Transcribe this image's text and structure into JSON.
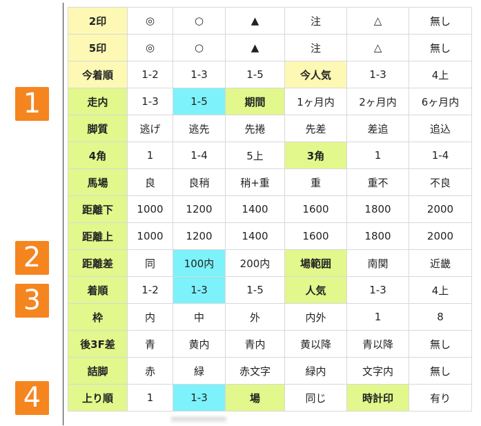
{
  "badges": [
    "1",
    "2",
    "3",
    "4"
  ],
  "colors": {
    "header_green": "#e2f78c",
    "header_yellow": "#fdf8b4",
    "highlight_cyan": "#7df2fb",
    "badge_orange": "#f5851f"
  },
  "rows": [
    {
      "cells": [
        {
          "text": "2印",
          "hdr": true,
          "color": "yellow"
        },
        {
          "text": "◎"
        },
        {
          "text": "○"
        },
        {
          "text": "▲"
        },
        {
          "text": "注"
        },
        {
          "text": "△"
        },
        {
          "text": "無し"
        }
      ]
    },
    {
      "cells": [
        {
          "text": "5印",
          "hdr": true,
          "color": "yellow"
        },
        {
          "text": "◎"
        },
        {
          "text": "○"
        },
        {
          "text": "▲"
        },
        {
          "text": "注"
        },
        {
          "text": "△"
        },
        {
          "text": "無し"
        }
      ]
    },
    {
      "cells": [
        {
          "text": "今着順",
          "hdr": true,
          "color": "yellow"
        },
        {
          "text": "1-2"
        },
        {
          "text": "1-3"
        },
        {
          "text": "1-5"
        },
        {
          "text": "今人気",
          "hdr": true,
          "color": "yellow"
        },
        {
          "text": "1-3"
        },
        {
          "text": "4上"
        }
      ]
    },
    {
      "cells": [
        {
          "text": "走内",
          "hdr": true,
          "color": "green"
        },
        {
          "text": "1-3"
        },
        {
          "text": "1-5",
          "color": "cyan"
        },
        {
          "text": "期間",
          "hdr": true,
          "color": "green"
        },
        {
          "text": "1ヶ月内"
        },
        {
          "text": "2ヶ月内"
        },
        {
          "text": "6ヶ月内"
        }
      ]
    },
    {
      "cells": [
        {
          "text": "脚質",
          "hdr": true,
          "color": "green"
        },
        {
          "text": "逃げ"
        },
        {
          "text": "逃先"
        },
        {
          "text": "先捲"
        },
        {
          "text": "先差"
        },
        {
          "text": "差追"
        },
        {
          "text": "追込"
        }
      ]
    },
    {
      "cells": [
        {
          "text": "4角",
          "hdr": true,
          "color": "green"
        },
        {
          "text": "1"
        },
        {
          "text": "1-4"
        },
        {
          "text": "5上"
        },
        {
          "text": "3角",
          "hdr": true,
          "color": "green"
        },
        {
          "text": "1"
        },
        {
          "text": "1-4"
        }
      ]
    },
    {
      "cells": [
        {
          "text": "馬場",
          "hdr": true,
          "color": "green"
        },
        {
          "text": "良"
        },
        {
          "text": "良稍"
        },
        {
          "text": "稍+重"
        },
        {
          "text": "重"
        },
        {
          "text": "重不"
        },
        {
          "text": "不良"
        }
      ]
    },
    {
      "cells": [
        {
          "text": "距離下",
          "hdr": true,
          "color": "green"
        },
        {
          "text": "1000"
        },
        {
          "text": "1200"
        },
        {
          "text": "1400"
        },
        {
          "text": "1600"
        },
        {
          "text": "1800"
        },
        {
          "text": "2000"
        }
      ]
    },
    {
      "cells": [
        {
          "text": "距離上",
          "hdr": true,
          "color": "green"
        },
        {
          "text": "1000"
        },
        {
          "text": "1200"
        },
        {
          "text": "1400"
        },
        {
          "text": "1600"
        },
        {
          "text": "1800"
        },
        {
          "text": "2000"
        }
      ]
    },
    {
      "cells": [
        {
          "text": "距離差",
          "hdr": true,
          "color": "green"
        },
        {
          "text": "同"
        },
        {
          "text": "100内",
          "color": "cyan"
        },
        {
          "text": "200内"
        },
        {
          "text": "場範囲",
          "hdr": true,
          "color": "green"
        },
        {
          "text": "南関"
        },
        {
          "text": "近畿"
        }
      ]
    },
    {
      "cells": [
        {
          "text": "着順",
          "hdr": true,
          "color": "green"
        },
        {
          "text": "1-2"
        },
        {
          "text": "1-3",
          "color": "cyan"
        },
        {
          "text": "1-5"
        },
        {
          "text": "人気",
          "hdr": true,
          "color": "green"
        },
        {
          "text": "1-3"
        },
        {
          "text": "4上"
        }
      ]
    },
    {
      "cells": [
        {
          "text": "枠",
          "hdr": true,
          "color": "green"
        },
        {
          "text": "内"
        },
        {
          "text": "中"
        },
        {
          "text": "外"
        },
        {
          "text": "内外"
        },
        {
          "text": "1"
        },
        {
          "text": "8"
        }
      ]
    },
    {
      "cells": [
        {
          "text": "後3F差",
          "hdr": true,
          "color": "green"
        },
        {
          "text": "青"
        },
        {
          "text": "黄内"
        },
        {
          "text": "青内"
        },
        {
          "text": "黄以降"
        },
        {
          "text": "青以降"
        },
        {
          "text": "無し"
        }
      ]
    },
    {
      "cells": [
        {
          "text": "詰脚",
          "hdr": true,
          "color": "green"
        },
        {
          "text": "赤"
        },
        {
          "text": "緑"
        },
        {
          "text": "赤文字"
        },
        {
          "text": "緑内"
        },
        {
          "text": "文字内"
        },
        {
          "text": "無し"
        }
      ]
    },
    {
      "cells": [
        {
          "text": "上り順",
          "hdr": true,
          "color": "green"
        },
        {
          "text": "1"
        },
        {
          "text": "1-3",
          "color": "cyan"
        },
        {
          "text": "場",
          "hdr": true,
          "color": "green"
        },
        {
          "text": "同じ"
        },
        {
          "text": "時計印",
          "hdr": true,
          "color": "green"
        },
        {
          "text": "有り"
        }
      ]
    }
  ]
}
